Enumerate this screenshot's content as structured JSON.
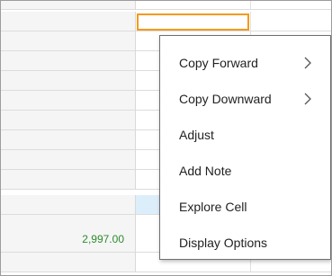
{
  "grid": {
    "highlighted_row_value": "2,997.00"
  },
  "context_menu": {
    "items": [
      {
        "label": "Copy Forward",
        "submenu": true,
        "icon": "chevron-right-icon"
      },
      {
        "label": "Copy Downward",
        "submenu": true,
        "icon": "chevron-right-icon"
      },
      {
        "label": "Adjust",
        "submenu": false
      },
      {
        "label": "Add Note",
        "submenu": false
      },
      {
        "label": "Explore Cell",
        "submenu": false
      },
      {
        "label": "Display Options",
        "submenu": false
      }
    ]
  },
  "colors": {
    "selection_border": "#f39a1c",
    "value_text": "#2e8b2e",
    "row_highlight": "#ddeefb"
  }
}
